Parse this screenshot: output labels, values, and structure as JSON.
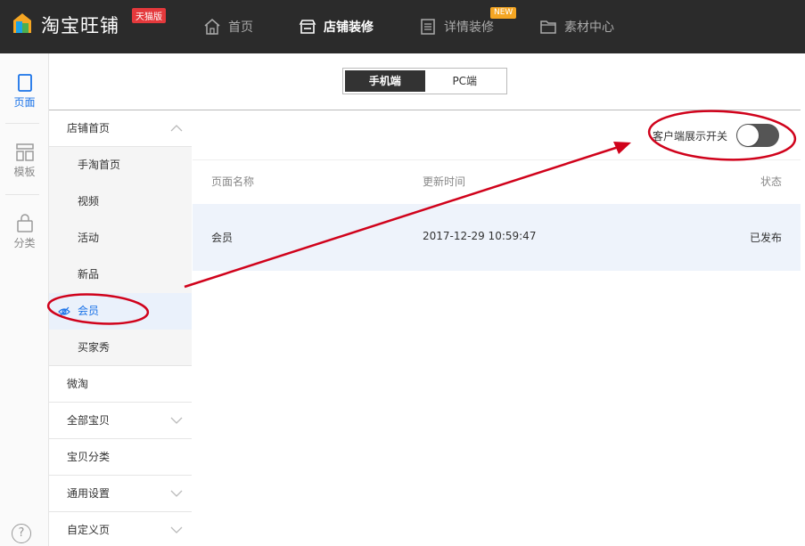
{
  "header": {
    "brand": "淘宝旺铺",
    "edition_badge": "天猫版",
    "nav": [
      {
        "label": "首页",
        "icon": "home-icon"
      },
      {
        "label": "店铺装修",
        "icon": "store-icon",
        "active": true
      },
      {
        "label": "详情装修",
        "icon": "document-icon",
        "badge": "NEW"
      },
      {
        "label": "素材中心",
        "icon": "folder-icon"
      }
    ]
  },
  "rail": {
    "items": [
      {
        "label": "页面",
        "icon": "page-icon",
        "active": true
      },
      {
        "label": "模板",
        "icon": "template-icon"
      },
      {
        "label": "分类",
        "icon": "bag-icon"
      }
    ],
    "help": "?"
  },
  "device_tabs": [
    {
      "label": "手机端",
      "selected": true
    },
    {
      "label": "PC端",
      "selected": false
    }
  ],
  "menu": {
    "shop_home": "店铺首页",
    "sub": [
      "手淘首页",
      "视频",
      "活动",
      "新品",
      "会员",
      "买家秀"
    ],
    "selected_sub": "会员",
    "others": [
      "微淘",
      "全部宝贝",
      "宝贝分类",
      "通用设置",
      "自定义页"
    ]
  },
  "content": {
    "switch_label": "客户端展示开关",
    "switch_on": false,
    "columns": [
      "页面名称",
      "更新时间",
      "状态"
    ],
    "rows": [
      {
        "name": "会员",
        "updated": "2017-12-29 10:59:47",
        "status": "已发布"
      }
    ]
  },
  "colors": {
    "topbar": "#2b2b2b",
    "accent": "#1a73e8",
    "annotation": "#d0021b",
    "badge_red": "#e4393c",
    "badge_new": "#f5a623"
  }
}
